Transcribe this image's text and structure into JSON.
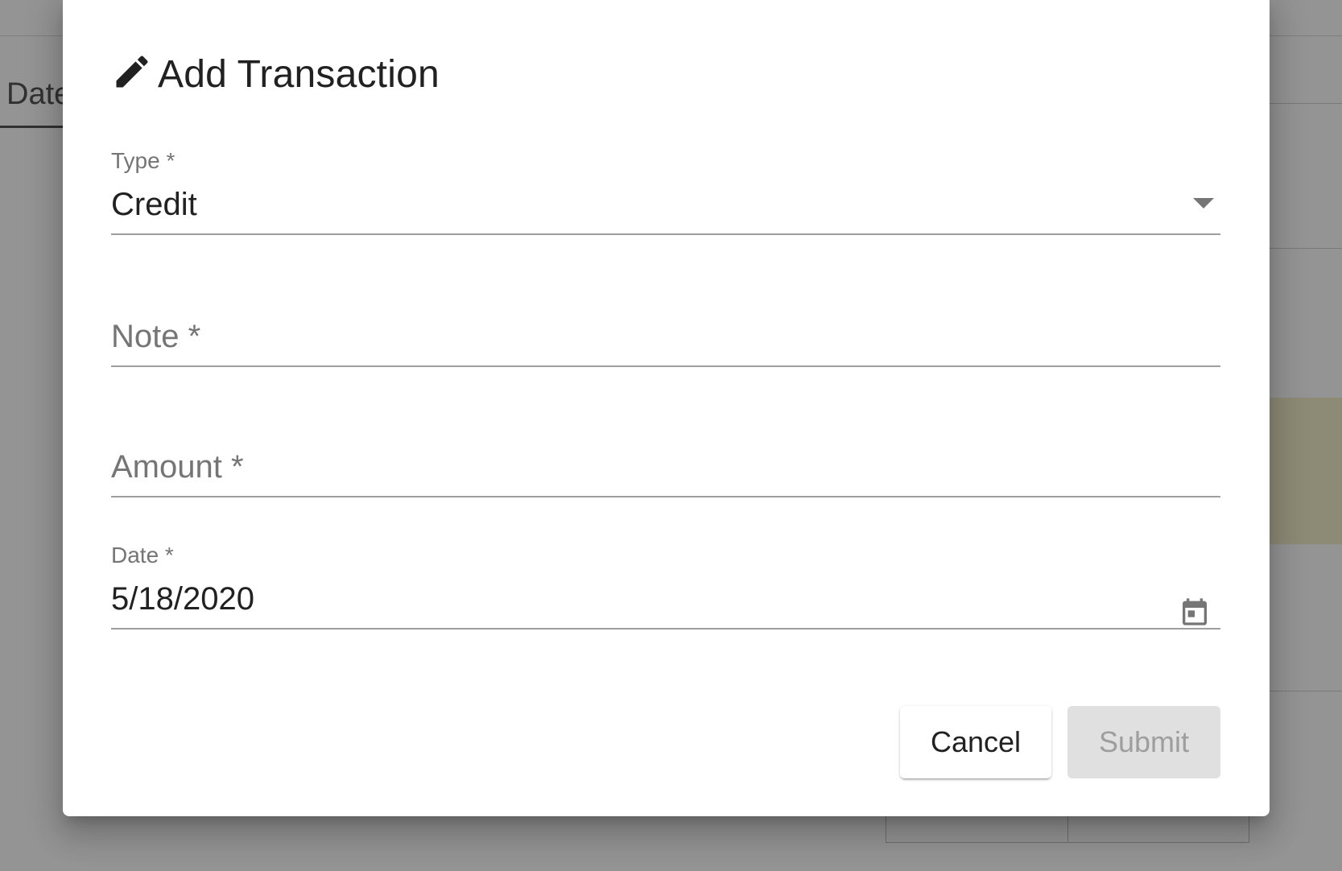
{
  "background": {
    "tab_label": "Date"
  },
  "dialog": {
    "title": "Add Transaction",
    "title_icon": "pencil-icon",
    "fields": {
      "type": {
        "label": "Type *",
        "value": "Credit",
        "icon": "chevron-down-icon"
      },
      "note": {
        "label": "Note *",
        "value": ""
      },
      "amount": {
        "label": "Amount *",
        "value": ""
      },
      "date": {
        "label": "Date *",
        "value": "5/18/2020",
        "icon": "calendar-icon"
      }
    },
    "actions": {
      "cancel_label": "Cancel",
      "submit_label": "Submit"
    }
  },
  "colors": {
    "backdrop": "#000000",
    "text_primary": "#212121",
    "text_secondary": "#757575",
    "underline": "#9e9e9e",
    "disabled_bg": "#e0e0e0",
    "disabled_text": "#9e9e9e",
    "highlight_row": "#f3efcc"
  }
}
